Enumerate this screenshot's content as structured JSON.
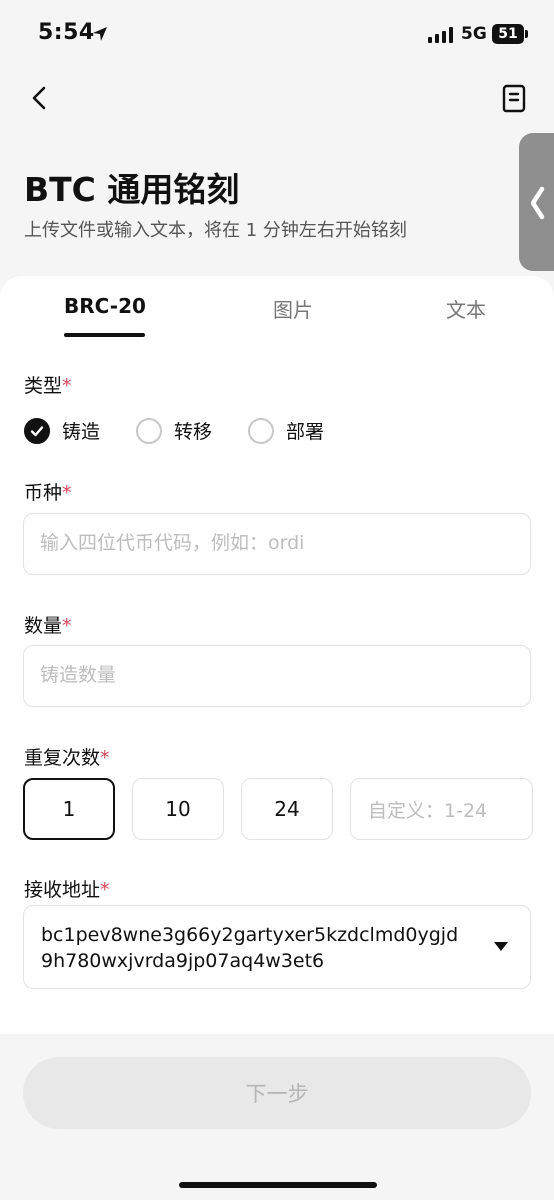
{
  "status_bar": {
    "time": "5:54",
    "network": "5G",
    "battery": "51"
  },
  "header": {
    "title": "BTC 通用铭刻",
    "subtitle": "上传文件或输入文本，将在 1 分钟左右开始铭刻"
  },
  "tabs": [
    {
      "label": "BRC-20",
      "active": true
    },
    {
      "label": "图片",
      "active": false
    },
    {
      "label": "文本",
      "active": false
    }
  ],
  "form": {
    "type": {
      "label": "类型",
      "required_mark": "*",
      "options": [
        {
          "label": "铸造",
          "selected": true
        },
        {
          "label": "转移",
          "selected": false
        },
        {
          "label": "部署",
          "selected": false
        }
      ]
    },
    "token": {
      "label": "币种",
      "required_mark": "*",
      "placeholder": "输入四位代币代码，例如：ordi",
      "value": ""
    },
    "amount": {
      "label": "数量",
      "required_mark": "*",
      "placeholder": "铸造数量",
      "value": ""
    },
    "repeat": {
      "label": "重复次数",
      "required_mark": "*",
      "options": [
        "1",
        "10",
        "24"
      ],
      "selected": "1",
      "custom_placeholder": "自定义：1-24"
    },
    "address": {
      "label": "接收地址",
      "required_mark": "*",
      "value": "bc1pev8wne3g66y2gartyxer5kzdclmd0ygjd9h780wxjvrda9jp07aq4w3et6"
    }
  },
  "footer": {
    "next_label": "下一步"
  },
  "colors": {
    "required": "#d6455a",
    "accent": "#111111",
    "disabled_button": "#e8e8e8"
  }
}
